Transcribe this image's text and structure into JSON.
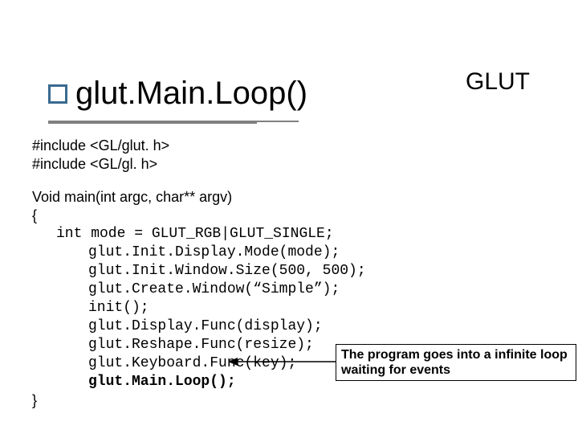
{
  "title": "glut.Main.Loop()",
  "corner_label": "GLUT",
  "code": {
    "inc1": "#include <GL/glut. h>",
    "inc2": "#include <GL/gl. h>",
    "sig": "Void main(int argc, char** argv)",
    "open": "{",
    "l1": "int mode = GLUT_RGB|GLUT_SINGLE;",
    "l2": "glut.Init.Display.Mode(mode);",
    "l3": "glut.Init.Window.Size(500, 500);",
    "l4": "glut.Create.Window(“Simple”);",
    "l5": "init();",
    "l6": "glut.Display.Func(display);",
    "l7": "glut.Reshape.Func(resize);",
    "l8": "glut.Keyboard.Func(key);",
    "l9": "glut.Main.Loop();",
    "close": "}"
  },
  "callout": "The program goes into a infinite loop waiting for events"
}
